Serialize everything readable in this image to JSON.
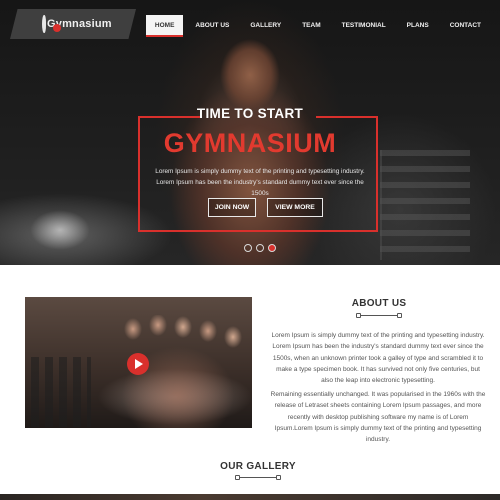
{
  "header": {
    "logo_text": "Gymnasium",
    "nav": [
      {
        "label": "HOME",
        "active": true
      },
      {
        "label": "ABOUT US",
        "active": false
      },
      {
        "label": "GALLERY",
        "active": false
      },
      {
        "label": "TEAM",
        "active": false
      },
      {
        "label": "TESTIMONIAL",
        "active": false
      },
      {
        "label": "PLANS",
        "active": false
      },
      {
        "label": "CONTACT",
        "active": false
      }
    ]
  },
  "hero": {
    "title_top": "TIME TO START",
    "title_main": "GYMNASIUM",
    "text": "Lorem Ipsum is simply dummy text of the printing and typesetting industry. Lorem Ipsum has been the industry's standard dummy text ever since the 1500s",
    "join_label": "JOIN NOW",
    "more_label": "VIEW MORE",
    "slides": 3,
    "active_slide": 3
  },
  "about": {
    "title": "ABOUT US",
    "paragraph1": "Lorem Ipsum is simply dummy text of the printing and typesetting industry. Lorem Ipsum has been the industry's standard dummy text ever since the 1500s, when an unknown printer took a galley of type and scrambled it to make a type specimen book. It has survived not only five centuries, but also the leap into electronic typesetting.",
    "paragraph2": "Remaining essentially unchanged. It was popularised in the 1960s with the release of Letraset sheets containing Lorem Ipsum passages, and more recently with desktop publishing software my name is of Lorem Ipsum.Lorem Ipsum is simply dummy text of the printing and typesetting industry."
  },
  "gallery": {
    "title": "OUR GALLERY"
  },
  "icons": {
    "logo": "flexing-arm-icon",
    "play": "play-icon",
    "divider": "dumbbell-icon"
  },
  "colors": {
    "accent": "#d9302c",
    "hero_title": "#e23a2f",
    "nav_active_bg": "#f4f4f4"
  }
}
